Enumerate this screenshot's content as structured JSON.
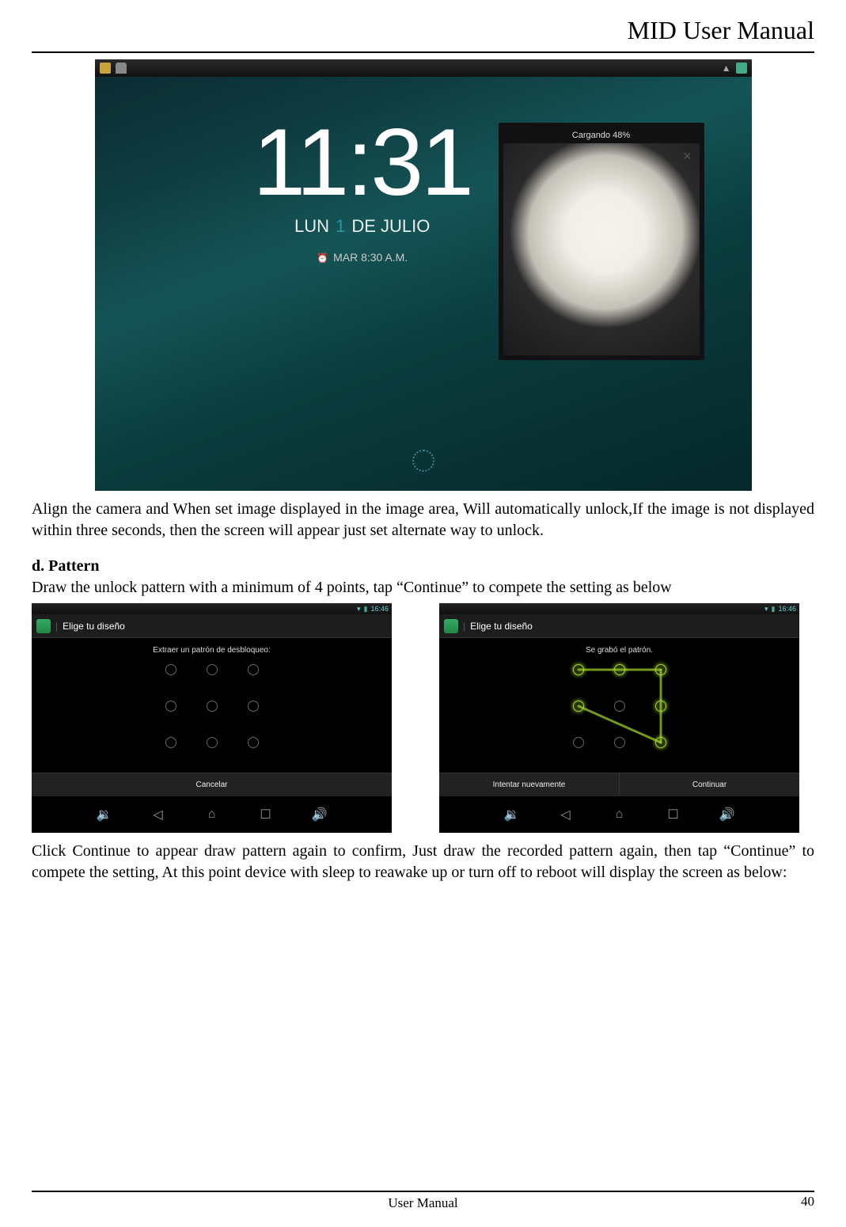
{
  "header": {
    "title": "MID User Manual"
  },
  "shot1": {
    "clock": "11:31",
    "day_prefix": "LUN",
    "day_num": "1",
    "day_suffix": "DE JULIO",
    "alarm": "MAR 8:30 A.M.",
    "face_label": "Cargando 48%",
    "face_close": "×"
  },
  "para1": "Align the camera and When set image displayed in the image area, Will automatically unlock,If the image is not displayed within three seconds, then the screen will appear just set alternate way to unlock.",
  "section_d": {
    "heading": "d. Pattern",
    "intro": "Draw the unlock pattern with a minimum of 4 points, tap “Continue” to compete the setting as below"
  },
  "shotA": {
    "status_time": "16:46",
    "title": "Elige tu diseño",
    "instruction": "Extraer un patrón de desbloqueo:",
    "button": "Cancelar"
  },
  "shotB": {
    "status_time": "16:46",
    "title": "Elige tu diseño",
    "instruction": "Se grabó el patrón.",
    "button_left": "Intentar nuevamente",
    "button_right": "Continuar"
  },
  "para2": "Click Continue to appear draw pattern again to confirm, Just draw the recorded pattern again, then tap “Continue” to compete the setting, At this point device with sleep to reawake up or turn off to reboot will display the screen as below:",
  "footer": {
    "center": "User Manual",
    "page": "40"
  }
}
